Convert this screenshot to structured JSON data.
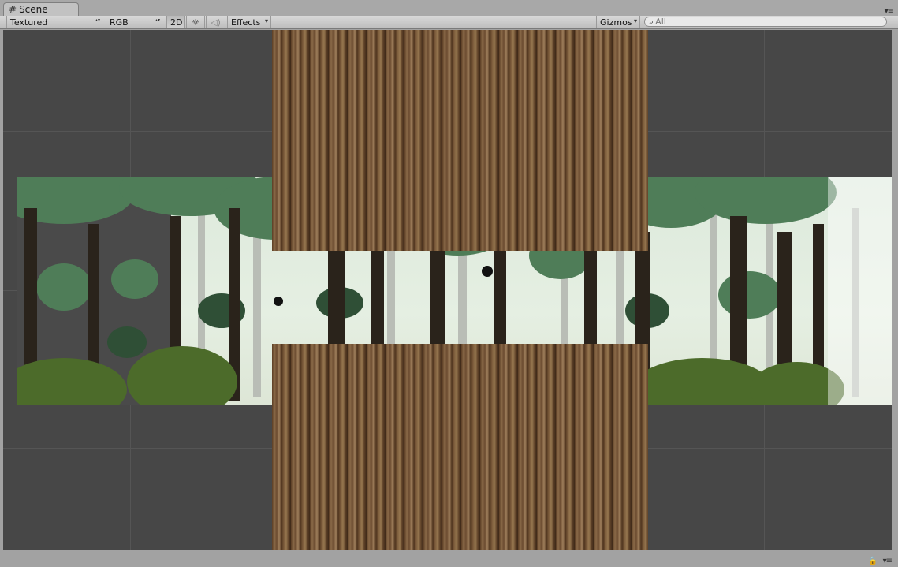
{
  "window": {
    "tab_title": "Scene",
    "tab_icon": "grid-icon",
    "panel_menu_glyph": "▾≡"
  },
  "toolbar": {
    "draw_mode": "Textured",
    "render_mode": "RGB",
    "mode_2d": "2D",
    "lighting_icon": "☼",
    "audio_icon": "◁)",
    "effects": "Effects",
    "gizmos": "Gizmos",
    "search_placeholder": "All",
    "search_icon": "⌕"
  },
  "footer": {
    "lock_icon": "🔒",
    "menu_icon": "▾≡"
  },
  "colors": {
    "scene_bg": "#474747",
    "forest_sky": "#e5efe2",
    "forest_dark": "#4a4a4a",
    "log_wood": "#6b4b30",
    "toolbar": "#cfcfcf"
  }
}
